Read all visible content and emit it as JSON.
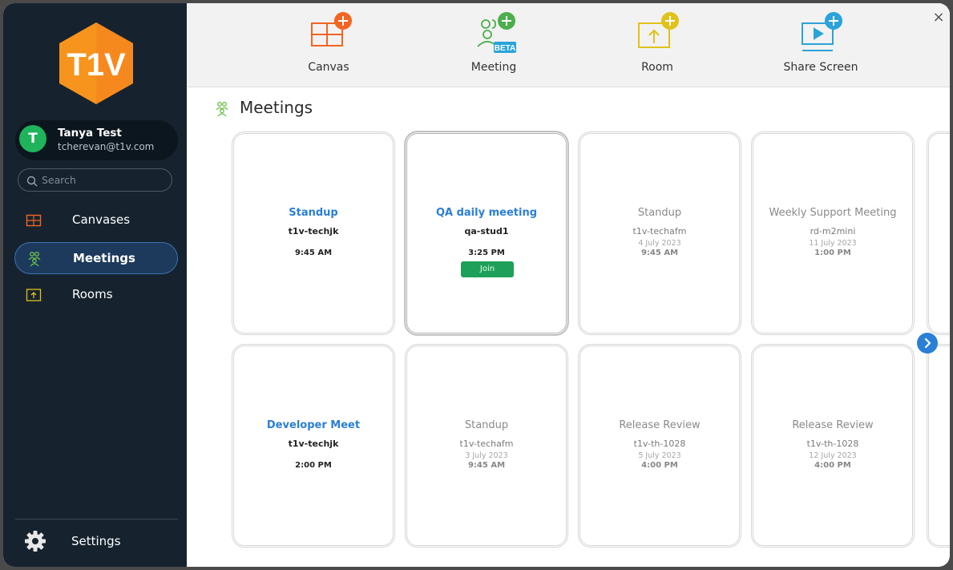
{
  "brand": {
    "logo_text": "T1V",
    "logo_color": "#f7941d"
  },
  "user": {
    "initial": "T",
    "name": "Tanya Test",
    "email": "tcherevan@t1v.com"
  },
  "search": {
    "placeholder": "Search"
  },
  "nav": [
    {
      "label": "Canvases",
      "icon": "canvas-icon",
      "active": false
    },
    {
      "label": "Meetings",
      "icon": "meetings-icon",
      "active": true
    },
    {
      "label": "Rooms",
      "icon": "room-icon",
      "active": false
    }
  ],
  "settings": {
    "label": "Settings",
    "icon": "gear-icon"
  },
  "toolbar": {
    "items": [
      {
        "label": "Canvas",
        "icon": "add-canvas-icon",
        "color": "#f26522"
      },
      {
        "label": "Meeting",
        "icon": "add-meeting-icon",
        "color": "#4cae4c",
        "badge": "BETA"
      },
      {
        "label": "Room",
        "icon": "add-room-icon",
        "color": "#e0c21a"
      },
      {
        "label": "Share Screen",
        "icon": "share-screen-icon",
        "color": "#2aa3d8"
      }
    ],
    "close": "×"
  },
  "page": {
    "title": "Meetings",
    "icon": "meetings-icon"
  },
  "meetings": [
    {
      "title": "Standup",
      "room": "t1v-techjk",
      "date": "",
      "time": "9:45 AM",
      "status": "upcoming"
    },
    {
      "title": "QA daily meeting",
      "room": "qa-stud1",
      "date": "",
      "time": "3:25 PM",
      "status": "upcoming",
      "join_label": "Join"
    },
    {
      "title": "Standup",
      "room": "t1v-techafm",
      "date": "4 July 2023",
      "time": "9:45 AM",
      "status": "past"
    },
    {
      "title": "Weekly Support Meeting",
      "room": "rd-m2mini",
      "date": "11 July 2023",
      "time": "1:00 PM",
      "status": "past"
    },
    {
      "title": "Developer Meet",
      "room": "t1v-techjk",
      "date": "",
      "time": "2:00 PM",
      "status": "upcoming"
    },
    {
      "title": "Standup",
      "room": "t1v-techafm",
      "date": "3 July 2023",
      "time": "9:45 AM",
      "status": "past"
    },
    {
      "title": "Release Review",
      "room": "t1v-th-1028",
      "date": "5 July 2023",
      "time": "4:00 PM",
      "status": "past"
    },
    {
      "title": "Release Review",
      "room": "t1v-th-1028",
      "date": "12 July 2023",
      "time": "4:00 PM",
      "status": "past"
    }
  ],
  "accent": "#2a7fd6"
}
